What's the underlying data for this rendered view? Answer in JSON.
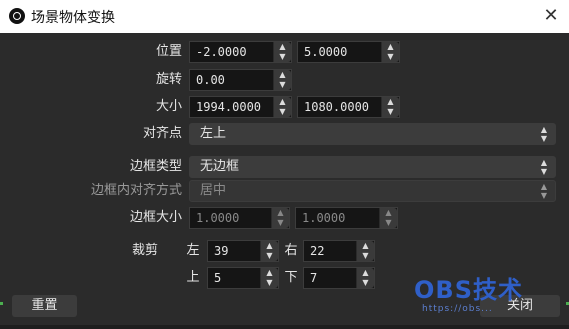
{
  "window": {
    "title": "场景物体变换",
    "close_glyph": "✕"
  },
  "form": {
    "position": {
      "label": "位置",
      "x": "-2.0000",
      "y": "5.0000"
    },
    "rotation": {
      "label": "旋转",
      "value": "0.00"
    },
    "size": {
      "label": "大小",
      "w": "1994.0000",
      "h": "1080.0000"
    },
    "alignment": {
      "label": "对齐点",
      "value": "左上"
    },
    "bounds_type": {
      "label": "边框类型",
      "value": "无边框"
    },
    "bounds_align": {
      "label": "边框内对齐方式",
      "value": "居中"
    },
    "bounds_size": {
      "label": "边框大小",
      "w": "1.0000",
      "h": "1.0000"
    },
    "crop": {
      "label": "裁剪",
      "left_label": "左",
      "left": "39",
      "right_label": "右",
      "right": "22",
      "top_label": "上",
      "top": "5",
      "bottom_label": "下",
      "bottom": "7"
    }
  },
  "buttons": {
    "reset": "重置",
    "close": "关闭"
  },
  "watermark": {
    "text": "OBS技术",
    "url": "https://obs..."
  },
  "colors": {
    "background": "#2b2b2b",
    "field": "#151515",
    "button": "#3c3c3c",
    "accent_watermark": "#2f5fc8"
  }
}
